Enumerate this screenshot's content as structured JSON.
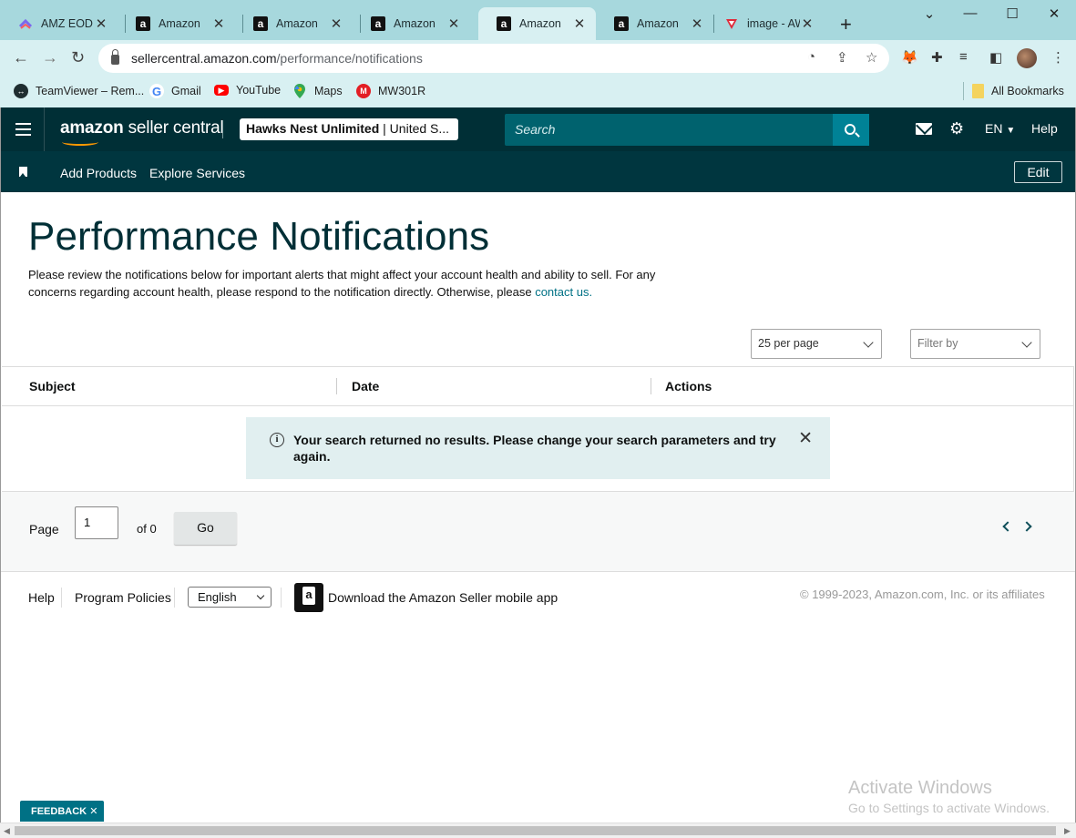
{
  "browser": {
    "tabs": [
      {
        "label": "AMZ EOD F",
        "favicon": "clickup-icon",
        "active": false
      },
      {
        "label": "Amazon",
        "favicon": "amazon-icon",
        "active": false
      },
      {
        "label": "Amazon",
        "favicon": "amazon-icon",
        "active": false
      },
      {
        "label": "Amazon",
        "favicon": "amazon-icon",
        "active": false
      },
      {
        "label": "Amazon",
        "favicon": "amazon-icon",
        "active": true
      },
      {
        "label": "Amazon",
        "favicon": "amazon-icon",
        "active": false
      },
      {
        "label": "image - AW",
        "favicon": "aws-red-icon",
        "active": false
      }
    ],
    "url_host": "sellercentral.amazon.com",
    "url_path": "/performance/notifications",
    "bookmarks": [
      {
        "label": "TeamViewer – Rem...",
        "icon": "teamviewer-icon"
      },
      {
        "label": "Gmail",
        "icon": "google-icon"
      },
      {
        "label": "YouTube",
        "icon": "youtube-icon"
      },
      {
        "label": "Maps",
        "icon": "maps-pin-icon"
      },
      {
        "label": "MW301R",
        "icon": "mercusys-icon"
      }
    ],
    "all_bookmarks": "All Bookmarks"
  },
  "header": {
    "logo_bold": "amazon",
    "logo_light": " seller central",
    "store_name": "Hawks Nest Unlimited",
    "store_region": " | United S...",
    "search_placeholder": "Search",
    "language": "EN",
    "help": "Help"
  },
  "subnav": {
    "add_products": "Add Products",
    "explore_services": "Explore Services",
    "edit": "Edit"
  },
  "main": {
    "title": "Performance Notifications",
    "intro_text": "Please review the notifications below for important alerts that might affect your account health and ability to sell. For any concerns regarding account health, please respond to the notification directly. Otherwise, please ",
    "contact_link": "contact us.",
    "per_page": "25 per page",
    "filter_placeholder": "Filter by",
    "columns": {
      "subject": "Subject",
      "date": "Date",
      "actions": "Actions"
    },
    "alert_message": "Your search returned no results. Please change your search parameters and try again."
  },
  "pager": {
    "page_label": "Page",
    "page_value": "1",
    "of_label": "of 0",
    "go": "Go"
  },
  "footer": {
    "help": "Help",
    "program_policies": "Program Policies",
    "language": "English",
    "download_app": "Download the Amazon Seller mobile app",
    "copyright": "© 1999-2023, Amazon.com, Inc. or its affiliates"
  },
  "windows": {
    "activate_title": "Activate Windows",
    "activate_sub": "Go to Settings to activate Windows."
  },
  "feedback": "FEEDBACK",
  "colors": {
    "header_bg": "#002f36",
    "subnav_bg": "#00363f",
    "search_bg": "#00626e",
    "search_btn": "#008296",
    "link": "#007185",
    "alert_bg": "#e1eff0",
    "chrome_frame": "#a7d8dd"
  }
}
